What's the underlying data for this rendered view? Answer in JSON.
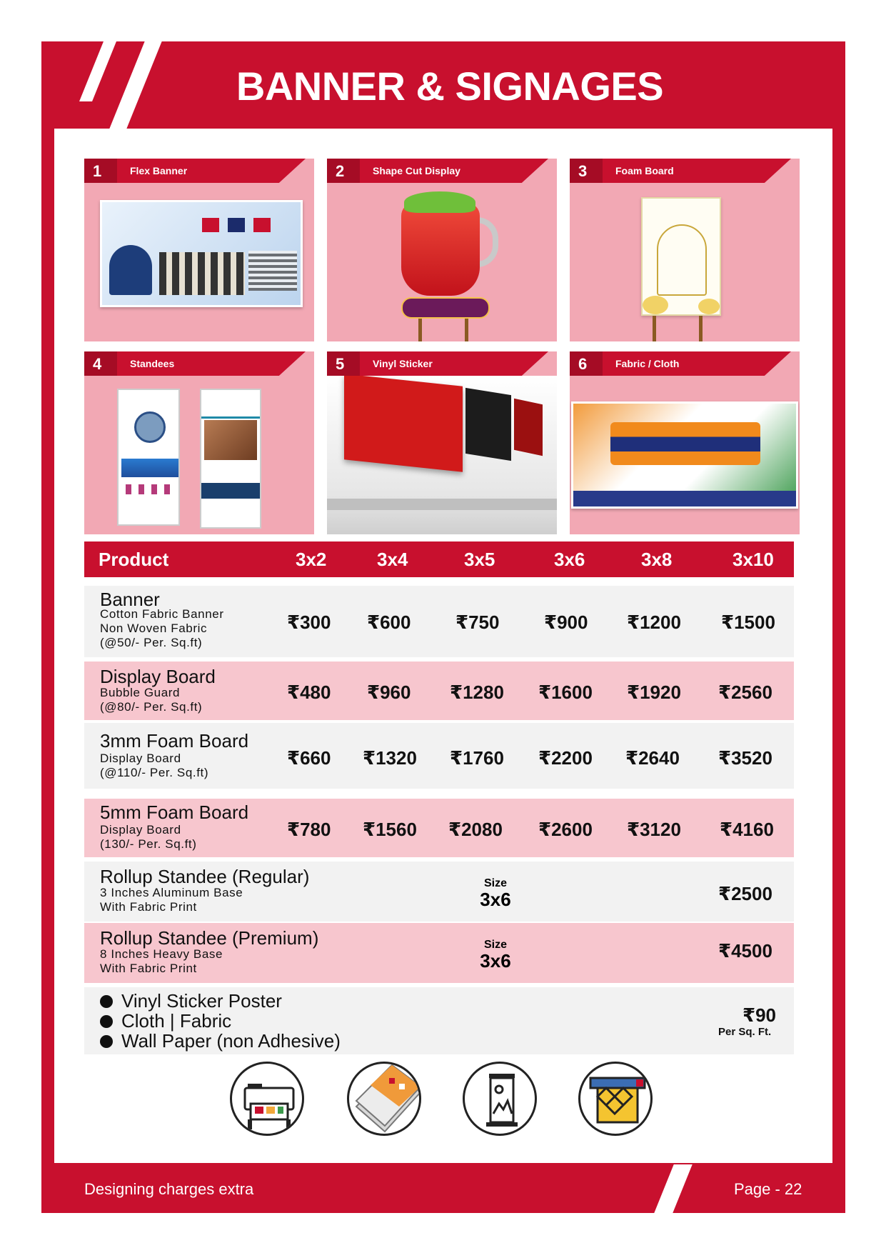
{
  "page": {
    "title": "BANNER & SIGNAGES",
    "footer_note": "Designing charges extra",
    "page_label": "Page - 22"
  },
  "tiles": [
    {
      "num": "1",
      "label": "Flex Banner"
    },
    {
      "num": "2",
      "label": "Shape Cut Display"
    },
    {
      "num": "3",
      "label": "Foam Board"
    },
    {
      "num": "4",
      "label": "Standees"
    },
    {
      "num": "5",
      "label": "Vinyl Sticker"
    },
    {
      "num": "6",
      "label": "Fabric / Cloth"
    }
  ],
  "table": {
    "headers": [
      "Product",
      "3x2",
      "3x4",
      "3x5",
      "3x6",
      "3x8",
      "3x10"
    ],
    "rows": [
      {
        "name": "Banner",
        "desc": [
          "Cotton Fabric Banner",
          "Non Woven Fabric",
          "(@50/- Per. Sq.ft)"
        ],
        "prices": [
          "₹300",
          "₹600",
          "₹750",
          "₹900",
          "₹1200",
          "₹1500"
        ]
      },
      {
        "name": "Display Board",
        "desc": [
          "Bubble Guard",
          "(@80/- Per. Sq.ft)"
        ],
        "prices": [
          "₹480",
          "₹960",
          "₹1280",
          "₹1600",
          "₹1920",
          "₹2560"
        ]
      },
      {
        "name": "3mm Foam Board",
        "desc": [
          "Display Board",
          "(@110/- Per. Sq.ft)"
        ],
        "prices": [
          "₹660",
          "₹1320",
          "₹1760",
          "₹2200",
          "₹2640",
          "₹3520"
        ]
      },
      {
        "name": "5mm Foam Board",
        "desc": [
          "Display Board",
          "(130/- Per. Sq.ft)"
        ],
        "prices": [
          "₹780",
          "₹1560",
          "₹2080",
          "₹2600",
          "₹3120",
          "₹4160"
        ]
      },
      {
        "name": "Rollup Standee (Regular)",
        "desc": [
          "3 Inches Aluminum Base",
          "With Fabric Print"
        ],
        "size_label": "Size",
        "size": "3x6",
        "price": "₹2500"
      },
      {
        "name": "Rollup Standee (Premium)",
        "desc": [
          "8 Inches Heavy Base",
          "With Fabric Print"
        ],
        "size_label": "Size",
        "size": "3x6",
        "price": "₹4500"
      }
    ],
    "misc": {
      "items": [
        "Vinyl Sticker Poster",
        "Cloth | Fabric",
        "Wall Paper (non Adhesive)"
      ],
      "price": "₹90",
      "unit": "Per Sq. Ft."
    }
  },
  "icons": [
    "printer-icon",
    "foam-board-layers-icon",
    "rollup-standee-icon",
    "wallpaper-printing-icon"
  ],
  "colors": {
    "brand_red": "#c8102e",
    "tile_pink": "#f2a8b4",
    "row_pink": "#f7c6ce",
    "row_grey": "#f2f2f2"
  }
}
